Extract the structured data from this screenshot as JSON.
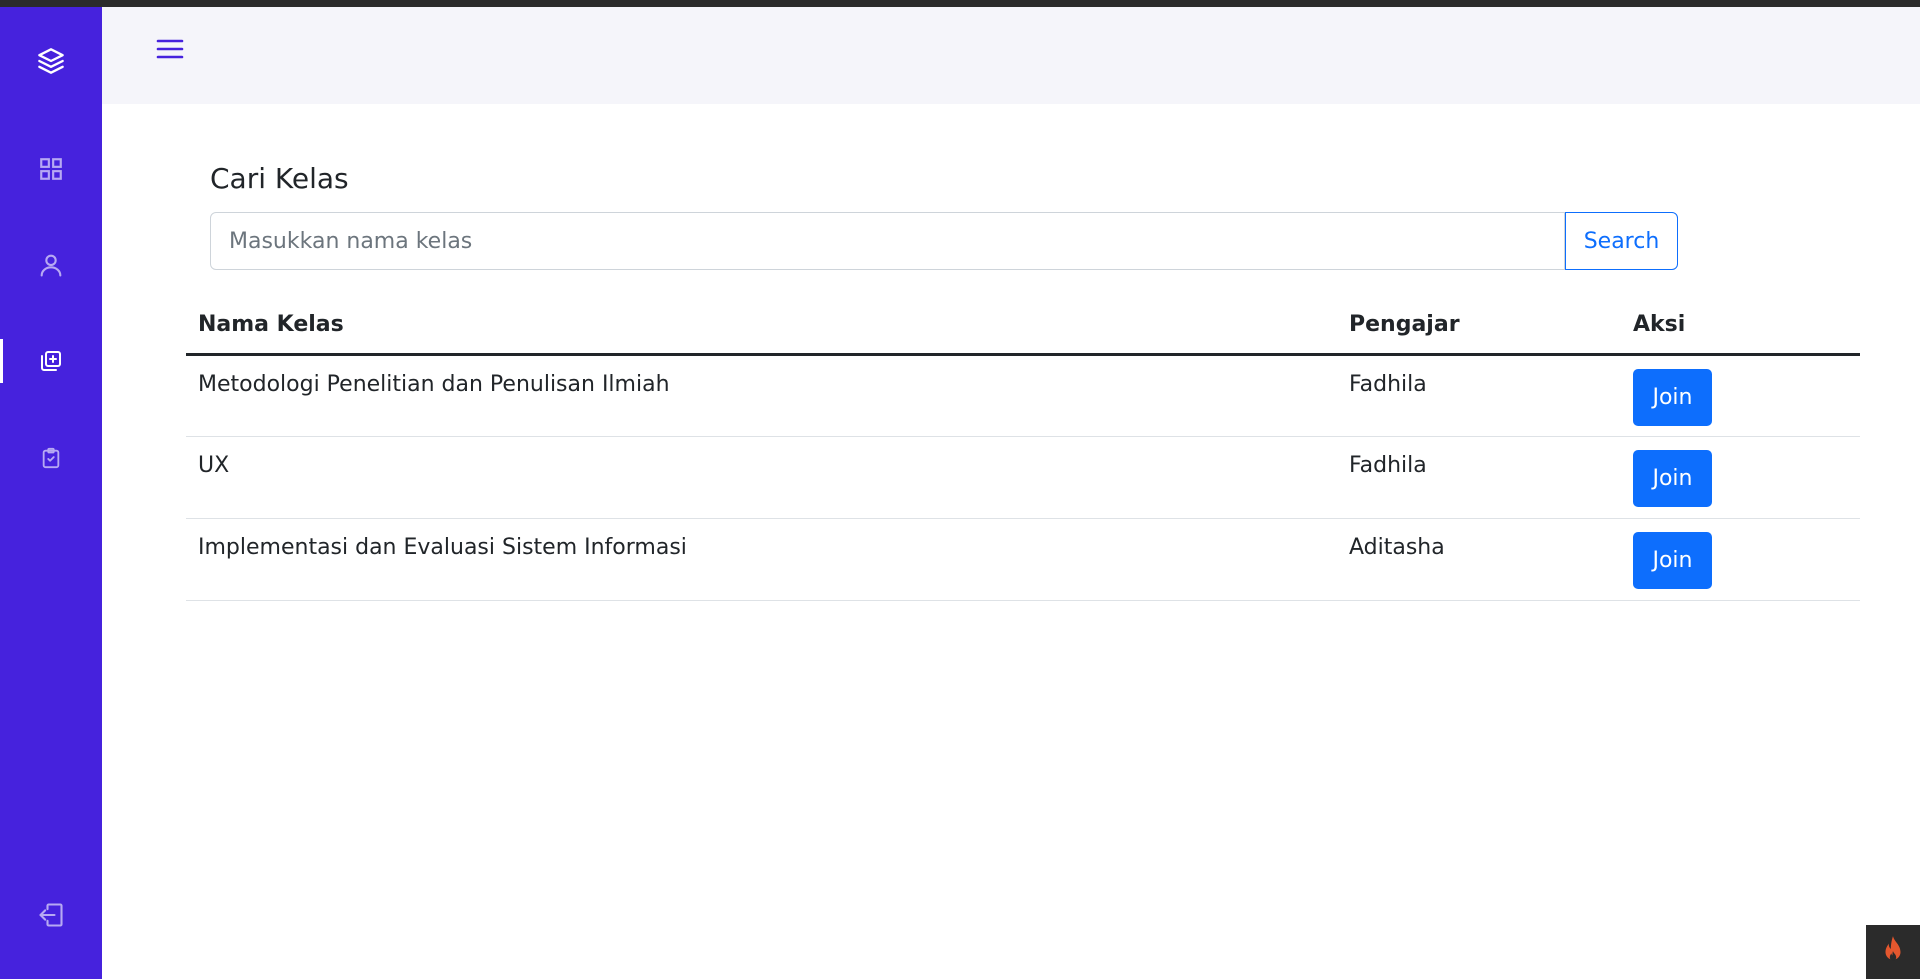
{
  "search": {
    "title": "Cari Kelas",
    "placeholder": "Masukkan nama kelas",
    "value": "",
    "button_label": "Search"
  },
  "table": {
    "headers": {
      "name": "Nama Kelas",
      "teacher": "Pengajar",
      "action": "Aksi"
    },
    "rows": [
      {
        "name": "Metodologi Penelitian dan Penulisan Ilmiah",
        "teacher": "Fadhila",
        "action": "Join"
      },
      {
        "name": "UX",
        "teacher": "Fadhila",
        "action": "Join"
      },
      {
        "name": "Implementasi dan Evaluasi Sistem Informasi",
        "teacher": "Aditasha",
        "action": "Join"
      }
    ]
  },
  "sidebar": {
    "items": [
      {
        "icon": "layers-icon"
      },
      {
        "icon": "grid-icon"
      },
      {
        "icon": "user-icon"
      },
      {
        "icon": "add-class-icon",
        "active": true
      },
      {
        "icon": "clipboard-check-icon"
      },
      {
        "icon": "logout-icon"
      }
    ]
  },
  "colors": {
    "sidebar": "#4622dd",
    "primary": "#0d6efd",
    "topbar": "#f5f5fa"
  }
}
